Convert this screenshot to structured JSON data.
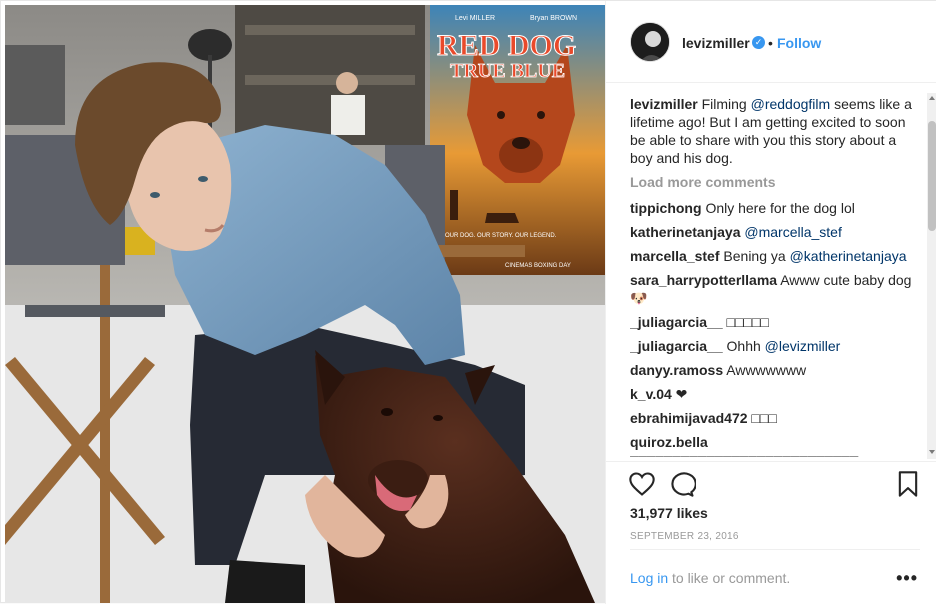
{
  "post": {
    "username": "levizmiller",
    "verified": true,
    "separator": "•",
    "follow_label": "Follow",
    "photo_alt": "",
    "poster": {
      "actor_left": "Levi MILLER",
      "actor_right": "Bryan BROWN",
      "title_line1": "RED DOG",
      "title_line2": "TRUE BLUE",
      "tagline": "OUR DOG. OUR STORY. OUR LEGEND.",
      "release": "CINEMAS BOXING DAY"
    },
    "caption": {
      "user": "levizmiller",
      "pre": "Filming ",
      "mention": "@reddogfilm",
      "post": " seems like a lifetime ago! But I am getting excited to soon be able to share with you this story about a boy and his dog."
    },
    "load_more": "Load more comments",
    "comments": [
      {
        "user": "tippichong",
        "text": "Only here for the dog lol",
        "mention": ""
      },
      {
        "user": "katherinetanjaya",
        "text": "",
        "mention": "@marcella_stef"
      },
      {
        "user": "marcella_stef",
        "text": "Bening ya ",
        "mention": "@katherinetanjaya"
      },
      {
        "user": "sara_harrypotterllama",
        "text": "Awww cute baby dog 🐶",
        "mention": ""
      },
      {
        "user": "_juliagarcia__",
        "text": "□□□□□",
        "mention": ""
      },
      {
        "user": "_juliagarcia__",
        "text": "Ohhh ",
        "mention": "@levizmiller"
      },
      {
        "user": "danyy.ramoss",
        "text": "Awwwwwww",
        "mention": ""
      },
      {
        "user": "k_v.04",
        "text": "❤",
        "mention": ""
      },
      {
        "user": "ebrahimijavad472",
        "text": "□□□",
        "mention": ""
      },
      {
        "user": "quiroz.bella",
        "text": "□□□□□□□□□□□□□□□□□□□□□□□□□□□",
        "mention": ""
      }
    ],
    "likes": "31,977 likes",
    "date": "SEPTEMBER 23, 2016",
    "login_link": "Log in",
    "login_rest": " to like or comment.",
    "more_label": "•••"
  },
  "icons": {
    "like": "heart-icon",
    "comment": "comment-bubble-icon",
    "save": "bookmark-icon",
    "verified": "verified-badge-icon",
    "more": "more-options-icon"
  },
  "colors": {
    "link": "#3897f0",
    "text": "#262626",
    "muted": "#999999",
    "mention": "#003569"
  }
}
